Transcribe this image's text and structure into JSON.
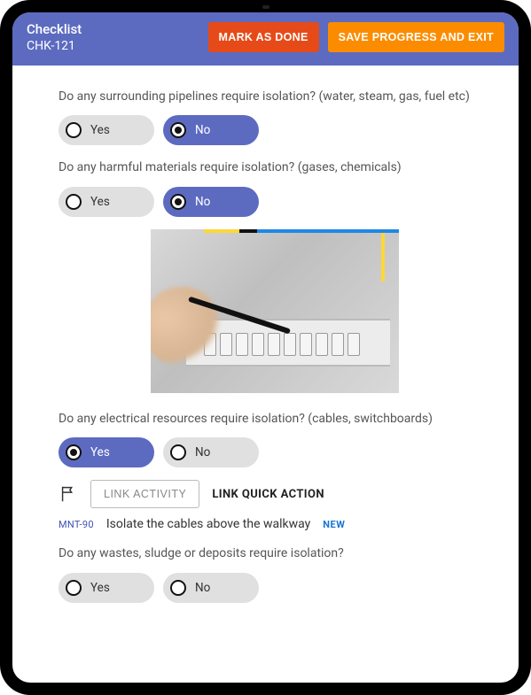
{
  "header": {
    "title": "Checklist",
    "subtitle": "CHK-121",
    "mark_done": "MARK AS DONE",
    "save_exit": "SAVE PROGRESS AND EXIT"
  },
  "options": {
    "yes": "Yes",
    "no": "No"
  },
  "questions": {
    "q1": "Do any surrounding pipelines require isolation? (water, steam, gas, fuel etc)",
    "q2": "Do any harmful materials require isolation? (gases, chemicals)",
    "q3": "Do any electrical resources require isolation? (cables, switchboards)",
    "q4": "Do any wastes, sludge or deposits require isolation?"
  },
  "links": {
    "link_activity": "LINK ACTIVITY",
    "link_quick": "LINK QUICK ACTION"
  },
  "linked": {
    "id": "MNT-90",
    "text": "Isolate the cables above the walkway",
    "badge": "NEW"
  }
}
